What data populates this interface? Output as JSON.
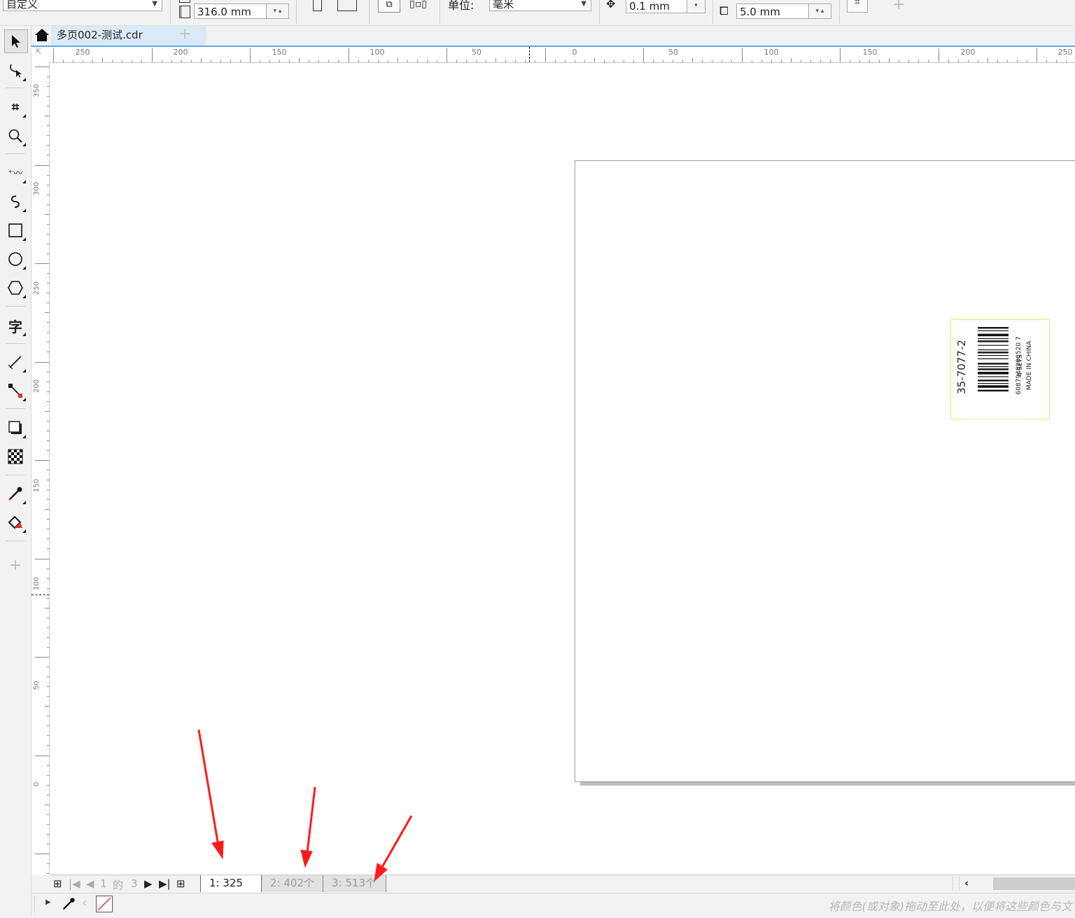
{
  "property_bar": {
    "page_size_preset": "自定义",
    "height_value": "316.0 mm",
    "units_label": "单位:",
    "units_value": "毫米",
    "nudge_value": "0.1 mm",
    "duplicate_distance_y": "5.0 mm"
  },
  "document": {
    "tab_title": "多页002-测试.cdr"
  },
  "ruler": {
    "h_labels": [
      "250",
      "200",
      "150",
      "100",
      "50",
      "0",
      "50",
      "100",
      "150",
      "200",
      "250"
    ],
    "v_labels": [
      "350",
      "300",
      "250",
      "200",
      "150",
      "100",
      "50",
      "0"
    ]
  },
  "label": {
    "code": "35-7077-2",
    "barcode_number": "6087948200520 7",
    "sets": "4 SETS",
    "origin": "MADE IN CHINA"
  },
  "page_nav": {
    "current": "1",
    "of": "的",
    "total": "3",
    "tabs": [
      "1: 325个",
      "2: 402个",
      "3: 513个"
    ]
  },
  "status": {
    "palette_hint": "将颜色(或对象)拖动至此处，以便将这些颜色与文"
  },
  "colors": {
    "accent": "#5aa9e6",
    "annotation_arrow": "#ff1a1a",
    "label_border": "#f3e27a"
  }
}
